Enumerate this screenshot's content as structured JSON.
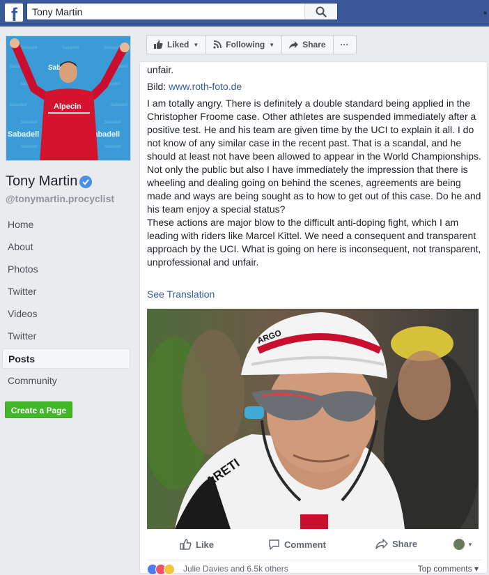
{
  "topbar": {
    "logo_letter": "f",
    "search_value": "Tony Martin"
  },
  "profile": {
    "name": "Tony Martin",
    "handle": "@tonymartin.procyclist",
    "cover_text": {
      "sponsor_big": "Sabadell",
      "jersey": "Alpecin"
    }
  },
  "nav": {
    "items": [
      "Home",
      "About",
      "Photos",
      "Twitter",
      "Videos",
      "Twitter",
      "Posts",
      "Community"
    ],
    "active": "Posts",
    "create_page": "Create a Page"
  },
  "action_bar": {
    "liked": "Liked",
    "following": "Following",
    "share": "Share",
    "more": "···"
  },
  "post": {
    "lines": [
      "unfair.",
      "Bild: ",
      "www.roth-foto.de",
      "I am totally angry. There is definitely a double standard being applied in the Christopher Froome case. Other athletes are suspended immediately after a positive test. He and his team are given time by the UCI to explain it all. I do not know of any similar case in the recent past. That is a scandal, and he should at least not have been allowed to appear in the World Championships.",
      "Not only the public but also I have immediately the impression that there is wheeling and dealing going on behind the scenes, agreements are being made and ways are being sought as to how to get out of this case. Do he and his team enjoy a special status?",
      "These actions are major blow to the difficult anti-doping fight, which I am leading with riders like Marcel Kittel. We need a consequent and transparent approach by the UCI. What is going on here is inconsequent, not transparent, unprofessional and unfair."
    ],
    "see_translation": "See Translation",
    "photo_helmet_text": "ARGO",
    "photo_jersey_text": "ARETI"
  },
  "post_actions": {
    "like": "Like",
    "comment": "Comment",
    "share": "Share"
  },
  "reactions": {
    "text": "Julie Davies and 6.5k others",
    "top_comments": "Top comments ▾"
  },
  "colors": {
    "facebook_blue": "#3b5998",
    "link": "#365899",
    "green": "#42b72a"
  }
}
